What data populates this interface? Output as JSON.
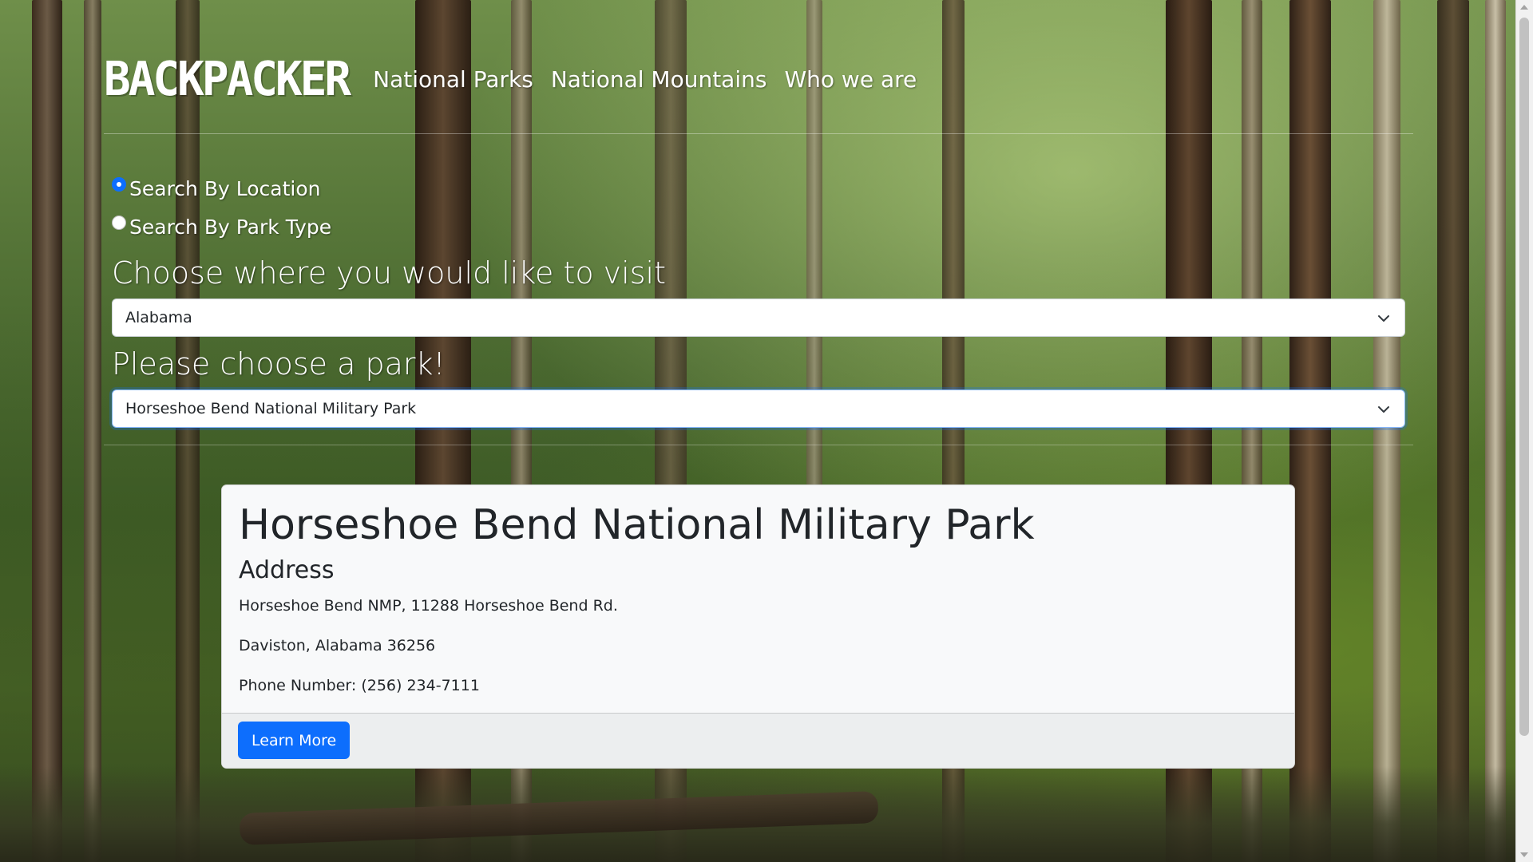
{
  "brand": "BACKPACKER",
  "nav": {
    "items": [
      {
        "label": "National Parks"
      },
      {
        "label": "National Mountains"
      },
      {
        "label": "Who we are"
      }
    ]
  },
  "search": {
    "options": [
      {
        "label": "Search By Location",
        "checked": true
      },
      {
        "label": "Search By Park Type",
        "checked": false
      }
    ],
    "location_heading": "Choose where you would like to visit",
    "location_value": "Alabama",
    "park_heading": "Please choose a park!",
    "park_value": "Horseshoe Bend National Military Park"
  },
  "card": {
    "title": "Horseshoe Bend National Military Park",
    "address_heading": "Address",
    "address_line1": "Horseshoe Bend NMP, 11288 Horseshoe Bend Rd.",
    "address_line2": "Daviston, Alabama 36256",
    "phone": "Phone Number: (256) 234-7111",
    "button_label": "Learn More"
  },
  "colors": {
    "primary": "#0d6efd",
    "card_bg": "#f8f9fa",
    "text": "#212529"
  }
}
